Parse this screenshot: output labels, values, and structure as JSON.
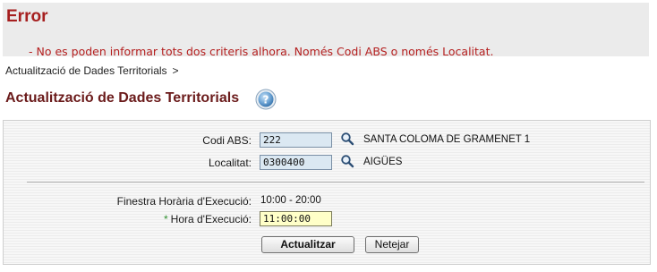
{
  "error": {
    "title": "Error",
    "message": "- No es poden informar tots dos criteris alhora. Només Codi ABS o només Localitat."
  },
  "breadcrumb": {
    "item": "Actualització de Dades Territorials",
    "separator": ">"
  },
  "page": {
    "title": "Actualització de Dades Territorials",
    "help_icon": "help-icon"
  },
  "form": {
    "codi_abs": {
      "label": "Codi ABS:",
      "value": "222",
      "description": "SANTA COLOMA DE GRAMENET 1"
    },
    "localitat": {
      "label": "Localitat:",
      "value": "0300400",
      "description": "AIGÜES"
    },
    "finestra": {
      "label": "Finestra Horària d'Execució:",
      "value": "10:00 - 20:00"
    },
    "hora": {
      "required_mark": "*",
      "label": "Hora d'Execució:",
      "value": "11:00:00"
    },
    "buttons": {
      "update": "Actualitzar",
      "clear": "Netejar"
    }
  },
  "colors": {
    "error_text": "#b52020",
    "title_text": "#6b1b1b",
    "field_blue": "#dbe8f2",
    "field_yellow": "#ffffc8"
  }
}
